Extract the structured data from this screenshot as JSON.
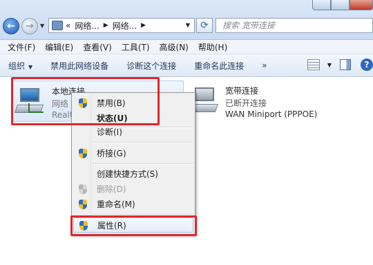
{
  "address": {
    "prefix": "«",
    "crumb1": "网络...",
    "crumb2": "网络..."
  },
  "search": {
    "placeholder": "搜索 宽带连接"
  },
  "menu": [
    "文件(F)",
    "编辑(E)",
    "查看(V)",
    "工具(T)",
    "高级(N)",
    "帮助(H)"
  ],
  "commands": {
    "organize": "组织",
    "disable": "禁用此网络设备",
    "diagnose": "诊断这个连接",
    "rename": "重命名此连接",
    "more": "»"
  },
  "connections": [
    {
      "name": "本地连接",
      "status": "网络",
      "device": "Realte"
    },
    {
      "name": "宽带连接",
      "status": "已断开连接",
      "device": "WAN Miniport (PPPOE)"
    }
  ],
  "context_menu": {
    "disable": "禁用(B)",
    "status": "状态(U)",
    "diagnose": "诊断(I)",
    "bridge": "桥接(G)",
    "shortcut": "创建快捷方式(S)",
    "delete": "删除(D)",
    "rename": "重命名(M)",
    "properties": "属性(R)"
  },
  "colors": {
    "highlight": "#e0262c",
    "accent": "#2b6bd2"
  }
}
